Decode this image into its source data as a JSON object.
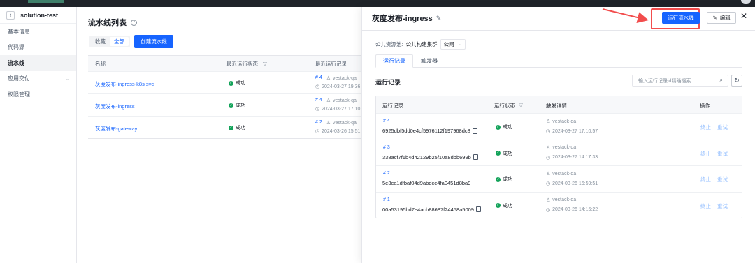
{
  "app": {
    "project_name": "solution-test"
  },
  "sidebar": {
    "items": [
      {
        "label": "基本信息",
        "active": false
      },
      {
        "label": "代码源",
        "active": false
      },
      {
        "label": "流水线",
        "active": true
      },
      {
        "label": "应用交付",
        "active": false,
        "has_chevron": true
      },
      {
        "label": "权限管理",
        "active": false
      }
    ]
  },
  "pipeline_list": {
    "title": "流水线列表",
    "filter": {
      "favorites": "收藏",
      "all": "全部",
      "selected": "全部"
    },
    "create_button": "创建流水线",
    "columns": {
      "name": "名称",
      "last_status": "最近运行状态",
      "last_record": "最近运行记录"
    },
    "rows": [
      {
        "name": "灰度发布-ingress-k8s svc",
        "status": "成功",
        "run_no": "# 4",
        "user": "vestack-qa",
        "time": "2024-03-27 19:36"
      },
      {
        "name": "灰度发布-ingress",
        "status": "成功",
        "run_no": "# 4",
        "user": "vestack-qa",
        "time": "2024-03-27 17:10"
      },
      {
        "name": "灰度发布-gateway",
        "status": "成功",
        "run_no": "# 2",
        "user": "vestack-qa",
        "time": "2024-03-26 15:51"
      }
    ]
  },
  "drawer": {
    "title": "灰度发布-ingress",
    "run_button": "运行流水线",
    "edit_button": "编辑",
    "resource_pool_label": "公共资源池:",
    "resource_pool_value": "公共构建集群",
    "network_value": "公网",
    "tabs": [
      {
        "label": "运行记录",
        "active": true
      },
      {
        "label": "触发器",
        "active": false
      }
    ],
    "section_title": "运行记录",
    "search_placeholder": "输入运行记录id精确搜索",
    "columns": {
      "record": "运行记录",
      "status": "运行状态",
      "trigger": "触发详情",
      "actions": "操作"
    },
    "records": [
      {
        "no": "# 4",
        "id": "6925dbf5dd0e4cf5976112f197968dc8",
        "status": "成功",
        "user": "vestack-qa",
        "time": "2024-03-27 17:10:57",
        "stop": "终止",
        "retry": "重试"
      },
      {
        "no": "# 3",
        "id": "338acf7f1b4d42129b25f10a8dbb699b",
        "status": "成功",
        "user": "vestack-qa",
        "time": "2024-03-27 14:17:33",
        "stop": "终止",
        "retry": "重试"
      },
      {
        "no": "# 2",
        "id": "5e3ca1dfbaf04d9abdce4fa0451d8ba9",
        "status": "成功",
        "user": "vestack-qa",
        "time": "2024-03-26 16:59:51",
        "stop": "终止",
        "retry": "重试"
      },
      {
        "no": "# 1",
        "id": "00a53195bd7e4acb88687f24458a5009",
        "status": "成功",
        "user": "vestack-qa",
        "time": "2024-03-26 14:16:22",
        "stop": "终止",
        "retry": "重试"
      }
    ]
  },
  "colors": {
    "primary": "#1664ff",
    "success": "#14a35a",
    "highlight": "#f24d4d"
  },
  "icons": [
    "back-icon",
    "help-icon",
    "filter-icon",
    "user-icon",
    "clock-icon",
    "pencil-icon",
    "close-icon",
    "search-icon",
    "refresh-icon",
    "copy-icon",
    "success-icon",
    "chevron-down-icon",
    "annotation-arrow-icon"
  ]
}
